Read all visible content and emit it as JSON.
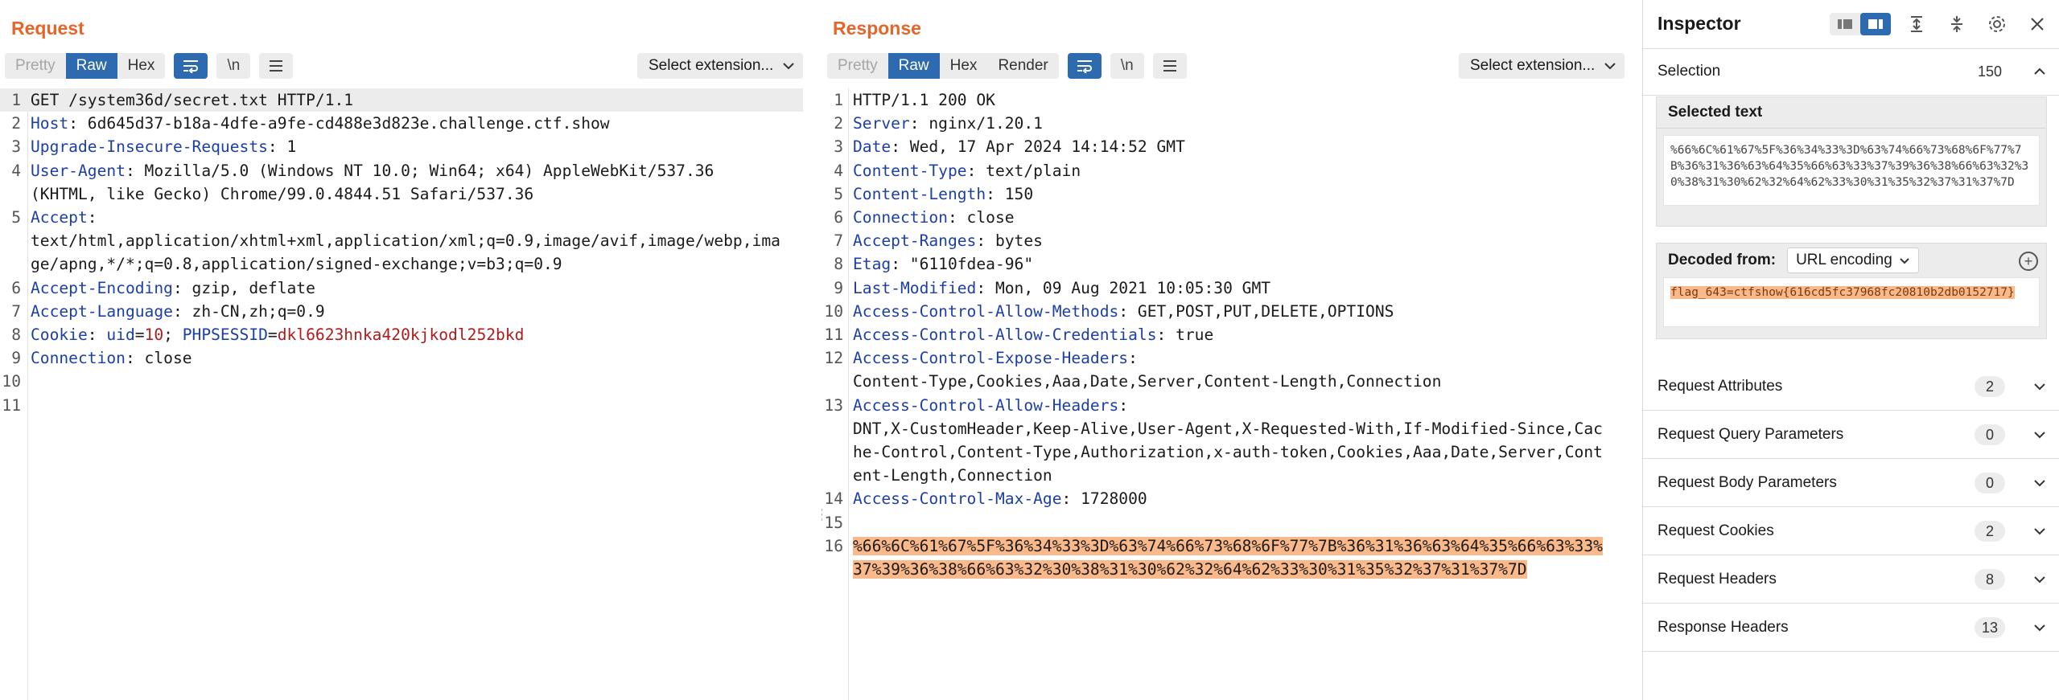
{
  "request": {
    "title": "Request",
    "tabs": [
      "Pretty",
      "Raw",
      "Hex"
    ],
    "active_tab": "Raw",
    "newline_btn": "\\n",
    "select_extension": "Select extension...",
    "lines": [
      {
        "n": "1",
        "parts": [
          {
            "t": "GET /system36d/secret.txt HTTP/1.1",
            "c": ""
          }
        ]
      },
      {
        "n": "2",
        "parts": [
          {
            "t": "Host",
            "c": "key"
          },
          {
            "t": ": 6d645d37-b18a-4dfe-a9fe-cd488e3d823e.challenge.ctf.show",
            "c": ""
          }
        ]
      },
      {
        "n": "3",
        "parts": [
          {
            "t": "Upgrade-Insecure-Requests",
            "c": "key"
          },
          {
            "t": ": 1",
            "c": ""
          }
        ]
      },
      {
        "n": "4",
        "parts": [
          {
            "t": "User-Agent",
            "c": "key"
          },
          {
            "t": ": Mozilla/5.0 (Windows NT 10.0; Win64; x64) AppleWebKit/537.36",
            "c": ""
          }
        ]
      },
      {
        "n": "",
        "parts": [
          {
            "t": "(KHTML, like Gecko) Chrome/99.0.4844.51 Safari/537.36",
            "c": ""
          }
        ]
      },
      {
        "n": "5",
        "parts": [
          {
            "t": "Accept",
            "c": "key"
          },
          {
            "t": ":",
            "c": ""
          }
        ]
      },
      {
        "n": "",
        "parts": [
          {
            "t": "text/html,application/xhtml+xml,application/xml;q=0.9,image/avif,image/webp,ima",
            "c": ""
          }
        ]
      },
      {
        "n": "",
        "parts": [
          {
            "t": "ge/apng,*/*;q=0.8,application/signed-exchange;v=b3;q=0.9",
            "c": ""
          }
        ]
      },
      {
        "n": "6",
        "parts": [
          {
            "t": "Accept-Encoding",
            "c": "key"
          },
          {
            "t": ": gzip, deflate",
            "c": ""
          }
        ]
      },
      {
        "n": "7",
        "parts": [
          {
            "t": "Accept-Language",
            "c": "key"
          },
          {
            "t": ": zh-CN,zh;q=0.9",
            "c": ""
          }
        ]
      },
      {
        "n": "8",
        "parts": [
          {
            "t": "Cookie",
            "c": "key"
          },
          {
            "t": ": ",
            "c": ""
          },
          {
            "t": "uid",
            "c": "key"
          },
          {
            "t": "=",
            "c": ""
          },
          {
            "t": "10",
            "c": "cval"
          },
          {
            "t": "; ",
            "c": ""
          },
          {
            "t": "PHPSESSID",
            "c": "key"
          },
          {
            "t": "=",
            "c": ""
          },
          {
            "t": "dkl6623hnka420kjkodl252bkd",
            "c": "cval"
          }
        ]
      },
      {
        "n": "9",
        "parts": [
          {
            "t": "Connection",
            "c": "key"
          },
          {
            "t": ": close",
            "c": ""
          }
        ]
      },
      {
        "n": "10",
        "parts": []
      },
      {
        "n": "11",
        "parts": []
      }
    ]
  },
  "response": {
    "title": "Response",
    "tabs": [
      "Pretty",
      "Raw",
      "Hex",
      "Render"
    ],
    "active_tab": "Raw",
    "newline_btn": "\\n",
    "select_extension": "Select extension...",
    "lines": [
      {
        "n": "1",
        "parts": [
          {
            "t": "HTTP/1.1 200 OK",
            "c": ""
          }
        ]
      },
      {
        "n": "2",
        "parts": [
          {
            "t": "Server",
            "c": "key"
          },
          {
            "t": ": nginx/1.20.1",
            "c": ""
          }
        ]
      },
      {
        "n": "3",
        "parts": [
          {
            "t": "Date",
            "c": "key"
          },
          {
            "t": ": Wed, 17 Apr 2024 14:14:52 GMT",
            "c": ""
          }
        ]
      },
      {
        "n": "4",
        "parts": [
          {
            "t": "Content-Type",
            "c": "key"
          },
          {
            "t": ": text/plain",
            "c": ""
          }
        ]
      },
      {
        "n": "5",
        "parts": [
          {
            "t": "Content-Length",
            "c": "key"
          },
          {
            "t": ": 150",
            "c": ""
          }
        ]
      },
      {
        "n": "6",
        "parts": [
          {
            "t": "Connection",
            "c": "key"
          },
          {
            "t": ": close",
            "c": ""
          }
        ]
      },
      {
        "n": "7",
        "parts": [
          {
            "t": "Accept-Ranges",
            "c": "key"
          },
          {
            "t": ": bytes",
            "c": ""
          }
        ]
      },
      {
        "n": "8",
        "parts": [
          {
            "t": "Etag",
            "c": "key"
          },
          {
            "t": ": \"6110fdea-96\"",
            "c": ""
          }
        ]
      },
      {
        "n": "9",
        "parts": [
          {
            "t": "Last-Modified",
            "c": "key"
          },
          {
            "t": ": Mon, 09 Aug 2021 10:05:30 GMT",
            "c": ""
          }
        ]
      },
      {
        "n": "10",
        "parts": [
          {
            "t": "Access-Control-Allow-Methods",
            "c": "key"
          },
          {
            "t": ": GET,POST,PUT,DELETE,OPTIONS",
            "c": ""
          }
        ]
      },
      {
        "n": "11",
        "parts": [
          {
            "t": "Access-Control-Allow-Credentials",
            "c": "key"
          },
          {
            "t": ": true",
            "c": ""
          }
        ]
      },
      {
        "n": "12",
        "parts": [
          {
            "t": "Access-Control-Expose-Headers",
            "c": "key"
          },
          {
            "t": ":",
            "c": ""
          }
        ]
      },
      {
        "n": "",
        "parts": [
          {
            "t": "Content-Type,Cookies,Aaa,Date,Server,Content-Length,Connection",
            "c": ""
          }
        ]
      },
      {
        "n": "13",
        "parts": [
          {
            "t": "Access-Control-Allow-Headers",
            "c": "key"
          },
          {
            "t": ":",
            "c": ""
          }
        ]
      },
      {
        "n": "",
        "parts": [
          {
            "t": "DNT,X-CustomHeader,Keep-Alive,User-Agent,X-Requested-With,If-Modified-Since,Cac",
            "c": ""
          }
        ]
      },
      {
        "n": "",
        "parts": [
          {
            "t": "he-Control,Content-Type,Authorization,x-auth-token,Cookies,Aaa,Date,Server,Cont",
            "c": ""
          }
        ]
      },
      {
        "n": "",
        "parts": [
          {
            "t": "ent-Length,Connection",
            "c": ""
          }
        ]
      },
      {
        "n": "14",
        "parts": [
          {
            "t": "Access-Control-Max-Age",
            "c": "key"
          },
          {
            "t": ": 1728000",
            "c": ""
          }
        ]
      },
      {
        "n": "15",
        "parts": []
      },
      {
        "n": "16",
        "parts": [
          {
            "t": "%66%6C%61%67%5F%36%34%33%3D%63%74%66%73%68%6F%77%7B%36%31%36%63%64%35%66%63%33%",
            "c": "sel"
          }
        ]
      },
      {
        "n": "",
        "parts": [
          {
            "t": "37%39%36%38%66%63%32%30%38%31%30%62%32%64%62%33%30%31%35%32%37%31%37%7D",
            "c": "sel"
          }
        ]
      }
    ]
  },
  "inspector": {
    "title": "Inspector",
    "selection_label": "Selection",
    "selection_count": "150",
    "selected_text_label": "Selected text",
    "selected_text": "%66%6C%61%67%5F%36%34%33%3D%63%74%66%73%68%6F%77%7B%36%31%36%63%64%35%66%63%33%37%39%36%38%66%63%32%30%38%31%30%62%32%64%62%33%30%31%35%32%37%31%37%7D",
    "decoded_from_label": "Decoded from:",
    "decoded_encoding": "URL encoding",
    "decoded_text": "flag_643=ctfshow{616cd5fc37968fc20810b2db0152717}",
    "sections": [
      {
        "label": "Request Attributes",
        "count": "2"
      },
      {
        "label": "Request Query Parameters",
        "count": "0"
      },
      {
        "label": "Request Body Parameters",
        "count": "0"
      },
      {
        "label": "Request Cookies",
        "count": "2"
      },
      {
        "label": "Request Headers",
        "count": "8"
      },
      {
        "label": "Response Headers",
        "count": "13"
      }
    ]
  },
  "icons": {
    "wrap": "wrap-icon",
    "menu": "menu-icon",
    "chevron": "chevron-down-icon",
    "settings": "gear-icon",
    "close": "close-icon"
  },
  "colors": {
    "accent_orange": "#e8652a",
    "active_blue": "#2d6ab0",
    "header_key": "#1c3fa6",
    "cookie_value": "#b01b1b",
    "selection": "#fab98a"
  }
}
